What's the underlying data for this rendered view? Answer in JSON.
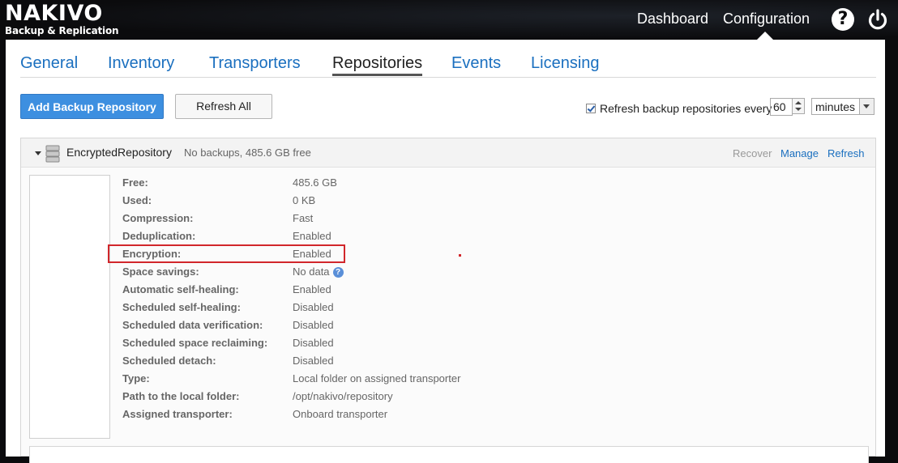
{
  "header": {
    "brand": "NAKIVO",
    "subbrand": "Backup & Replication",
    "nav": [
      "Dashboard",
      "Configuration"
    ],
    "active_nav": "Configuration",
    "help_icon": "?"
  },
  "tabs": [
    {
      "label": "General"
    },
    {
      "label": "Inventory"
    },
    {
      "label": "Transporters"
    },
    {
      "label": "Repositories",
      "active": true
    },
    {
      "label": "Events"
    },
    {
      "label": "Licensing"
    }
  ],
  "toolbar": {
    "add_label": "Add Backup Repository",
    "refresh_all_label": "Refresh All",
    "auto_refresh_label": "Refresh backup repositories every",
    "auto_refresh_checked": true,
    "interval_value": "60",
    "interval_unit": "minutes"
  },
  "repository": {
    "name": "EncryptedRepository",
    "summary": "No backups, 485.6 GB free",
    "actions": {
      "recover": "Recover",
      "manage": "Manage",
      "refresh": "Refresh"
    },
    "details": [
      {
        "label": "Free:",
        "value": "485.6 GB"
      },
      {
        "label": "Used:",
        "value": "0 KB"
      },
      {
        "label": "Compression:",
        "value": "Fast"
      },
      {
        "label": "Deduplication:",
        "value": "Enabled"
      },
      {
        "label": "Encryption:",
        "value": "Enabled"
      },
      {
        "label": "Space savings:",
        "value": "No data"
      },
      {
        "label": "Automatic self-healing:",
        "value": "Enabled"
      },
      {
        "label": "Scheduled self-healing:",
        "value": "Disabled"
      },
      {
        "label": "Scheduled data verification:",
        "value": "Disabled"
      },
      {
        "label": "Scheduled space reclaiming:",
        "value": "Disabled"
      },
      {
        "label": "Scheduled detach:",
        "value": "Disabled"
      },
      {
        "label": "Type:",
        "value": "Local folder on assigned transporter"
      },
      {
        "label": "Path to the local folder:",
        "value": "/opt/nakivo/repository"
      },
      {
        "label": "Assigned transporter:",
        "value": "Onboard transporter"
      }
    ],
    "help_icon": "?"
  },
  "colors": {
    "link": "#1a6fbf",
    "primary_button": "#3d8fe0",
    "highlight": "#d1262b"
  }
}
